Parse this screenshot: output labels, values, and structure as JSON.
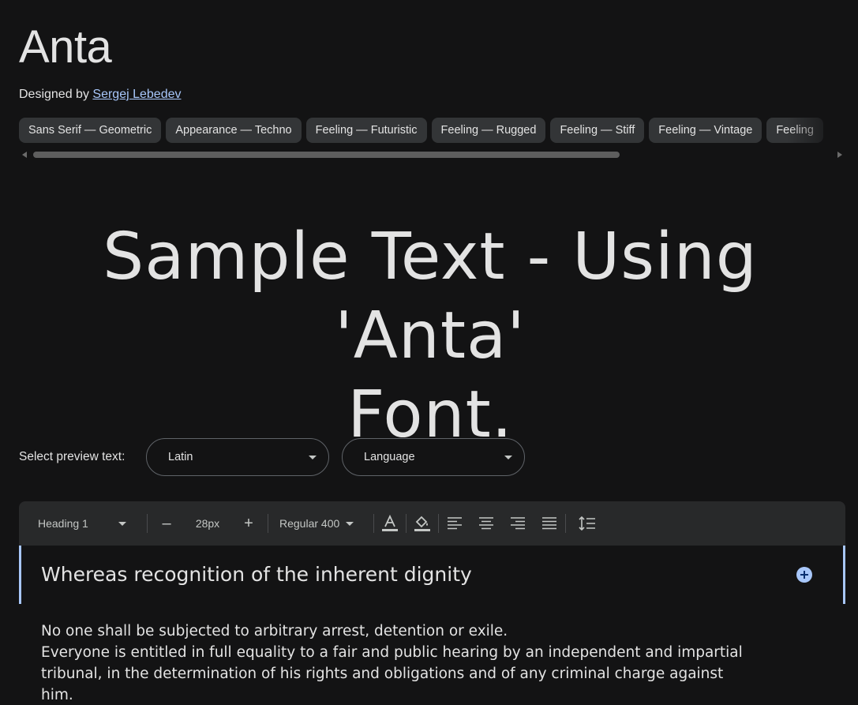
{
  "font": {
    "name": "Anta",
    "designed_by_label": "Designed by",
    "designer": "Sergej Lebedev"
  },
  "tags": [
    "Sans Serif — Geometric",
    "Appearance — Techno",
    "Feeling — Futuristic",
    "Feeling — Rugged",
    "Feeling — Stiff",
    "Feeling — Vintage",
    "Feeling"
  ],
  "sample": {
    "line1": "Sample Text - Using 'Anta'",
    "line2": "Font."
  },
  "preview": {
    "label": "Select preview text:",
    "script_value": "Latin",
    "language_value": "Language"
  },
  "toolbar": {
    "style": "Heading 1",
    "decrease": "–",
    "size": "28px",
    "increase": "+",
    "weight": "Regular 400"
  },
  "editor": {
    "heading": "Whereas recognition of the inherent dignity",
    "paragraphs": [
      "No one shall be subjected to arbitrary arrest, detention or exile.",
      "Everyone is entitled in full equality to a fair and public hearing by an independent and impartial tribunal, in the determination of his rights and obligations and of any criminal charge against him."
    ]
  },
  "colors": {
    "background": "#131314",
    "accent": "#a8c7fa",
    "chip": "#333537",
    "toolbar": "#28292a"
  }
}
